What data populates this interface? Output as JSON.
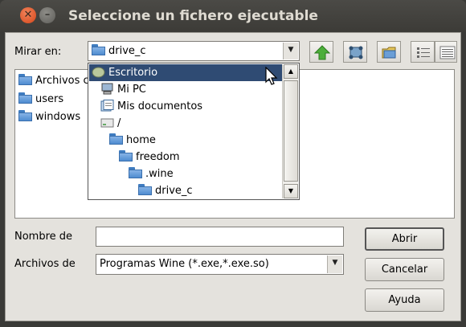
{
  "window": {
    "title": "Seleccione un fichero ejecutable"
  },
  "look_in": {
    "label": "Mirar en:",
    "value": "drive_c"
  },
  "file_list": {
    "items": [
      {
        "label": "Archivos c",
        "icon": "folder-icon"
      },
      {
        "label": "users",
        "icon": "folder-icon"
      },
      {
        "label": "windows",
        "icon": "folder-icon"
      }
    ]
  },
  "location_dropdown": {
    "items": [
      {
        "label": "Escritorio",
        "icon": "desktop-icon",
        "selected": true
      },
      {
        "label": "Mi PC",
        "icon": "computer-icon"
      },
      {
        "label": "Mis documentos",
        "icon": "documents-icon"
      },
      {
        "label": "/",
        "icon": "drive-icon"
      },
      {
        "label": "home",
        "icon": "folder-icon"
      },
      {
        "label": "freedom",
        "icon": "folder-icon"
      },
      {
        "label": ".wine",
        "icon": "folder-icon"
      },
      {
        "label": "drive_c",
        "icon": "folder-icon"
      }
    ]
  },
  "filename": {
    "label": "Nombre de",
    "value": ""
  },
  "filetype": {
    "label": "Archivos de",
    "value": "Programas Wine (*.exe,*.exe.so)"
  },
  "buttons": {
    "open": "Abrir",
    "cancel": "Cancelar",
    "help": "Ayuda"
  },
  "colors": {
    "selection": "#2f4b73",
    "titlebar": "#3c3b37",
    "dialog": "#e4e2dd"
  }
}
